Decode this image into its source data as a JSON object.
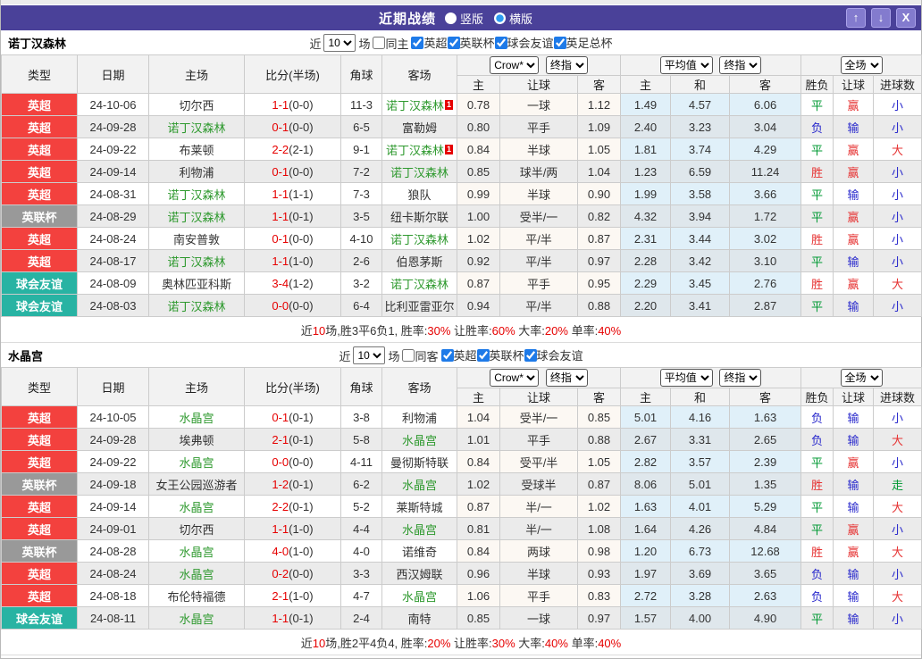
{
  "theme": {
    "titlebar_purple": "#4a4199",
    "epl_red": "#f3413e",
    "league_cup_gray": "#999999",
    "friendly_teal": "#28b3a3",
    "focus_team_green": "#2e992e",
    "score_red": "#e60000",
    "win_red": "#e63333",
    "draw_green": "#009933",
    "lose_blue": "#2929cc"
  },
  "titlebar": {
    "title": "近期战绩",
    "layout_options": [
      {
        "label": "竖版",
        "selected": false
      },
      {
        "label": "横版",
        "selected": true
      }
    ],
    "up_icon": "↑",
    "down_icon": "↓",
    "close_icon": "X"
  },
  "header": {
    "type": "类型",
    "date": "日期",
    "home": "主场",
    "score": "比分(半场)",
    "corner": "角球",
    "away": "客场",
    "odds_company": "Crow*",
    "odds_stage": "终指",
    "avg": "平均值",
    "avg_stage": "终指",
    "scope": "全场",
    "sub": [
      "主",
      "让球",
      "客",
      "主",
      "和",
      "客",
      "胜负",
      "让球",
      "进球数"
    ]
  },
  "tables": [
    {
      "team": "诺丁汉森林",
      "filter": {
        "near_label": "近",
        "games_value": "10",
        "games_label": "场",
        "same_label": "同主",
        "same_checked": false,
        "leagues": [
          {
            "label": "英超",
            "checked": true
          },
          {
            "label": "英联杯",
            "checked": true
          },
          {
            "label": "球会友谊",
            "checked": true
          },
          {
            "label": "英足总杯",
            "checked": true
          }
        ]
      },
      "rows": [
        {
          "league": "英超",
          "lg": "epl",
          "date": "24-10-06",
          "home": "切尔西",
          "home_focus": false,
          "score": "1-1",
          "half": "(0-0)",
          "corner": "11-3",
          "away": "诺丁汉森林",
          "away_focus": true,
          "away_rc": "1",
          "odds": [
            "0.78",
            "一球",
            "1.12"
          ],
          "avg": [
            "1.49",
            "4.57",
            "6.06"
          ],
          "res": [
            [
              "平",
              "g"
            ],
            [
              "赢",
              "r"
            ],
            [
              "小",
              "b"
            ]
          ]
        },
        {
          "league": "英超",
          "lg": "epl",
          "date": "24-09-28",
          "home": "诺丁汉森林",
          "home_focus": true,
          "score": "0-1",
          "half": "(0-0)",
          "corner": "6-5",
          "away": "富勒姆",
          "away_focus": false,
          "odds": [
            "0.80",
            "平手",
            "1.09"
          ],
          "avg": [
            "2.40",
            "3.23",
            "3.04"
          ],
          "res": [
            [
              "负",
              "b"
            ],
            [
              "输",
              "b"
            ],
            [
              "小",
              "b"
            ]
          ]
        },
        {
          "league": "英超",
          "lg": "epl",
          "date": "24-09-22",
          "home": "布莱顿",
          "home_focus": false,
          "score": "2-2",
          "half": "(2-1)",
          "corner": "9-1",
          "away": "诺丁汉森林",
          "away_focus": true,
          "away_rc": "1",
          "odds": [
            "0.84",
            "半球",
            "1.05"
          ],
          "avg": [
            "1.81",
            "3.74",
            "4.29"
          ],
          "res": [
            [
              "平",
              "g"
            ],
            [
              "赢",
              "r"
            ],
            [
              "大",
              "r"
            ]
          ]
        },
        {
          "league": "英超",
          "lg": "epl",
          "date": "24-09-14",
          "home": "利物浦",
          "home_focus": false,
          "score": "0-1",
          "half": "(0-0)",
          "corner": "7-2",
          "away": "诺丁汉森林",
          "away_focus": true,
          "odds": [
            "0.85",
            "球半/两",
            "1.04"
          ],
          "avg": [
            "1.23",
            "6.59",
            "11.24"
          ],
          "res": [
            [
              "胜",
              "r"
            ],
            [
              "赢",
              "r"
            ],
            [
              "小",
              "b"
            ]
          ]
        },
        {
          "league": "英超",
          "lg": "epl",
          "date": "24-08-31",
          "home": "诺丁汉森林",
          "home_focus": true,
          "score": "1-1",
          "half": "(1-1)",
          "corner": "7-3",
          "away": "狼队",
          "away_focus": false,
          "odds": [
            "0.99",
            "半球",
            "0.90"
          ],
          "avg": [
            "1.99",
            "3.58",
            "3.66"
          ],
          "res": [
            [
              "平",
              "g"
            ],
            [
              "输",
              "b"
            ],
            [
              "小",
              "b"
            ]
          ]
        },
        {
          "league": "英联杯",
          "lg": "cup",
          "date": "24-08-29",
          "home": "诺丁汉森林",
          "home_focus": true,
          "score": "1-1",
          "half": "(0-1)",
          "corner": "3-5",
          "away": "纽卡斯尔联",
          "away_focus": false,
          "odds": [
            "1.00",
            "受半/一",
            "0.82"
          ],
          "avg": [
            "4.32",
            "3.94",
            "1.72"
          ],
          "res": [
            [
              "平",
              "g"
            ],
            [
              "赢",
              "r"
            ],
            [
              "小",
              "b"
            ]
          ]
        },
        {
          "league": "英超",
          "lg": "epl",
          "date": "24-08-24",
          "home": "南安普敦",
          "home_focus": false,
          "score": "0-1",
          "half": "(0-0)",
          "corner": "4-10",
          "away": "诺丁汉森林",
          "away_focus": true,
          "odds": [
            "1.02",
            "平/半",
            "0.87"
          ],
          "avg": [
            "2.31",
            "3.44",
            "3.02"
          ],
          "res": [
            [
              "胜",
              "r"
            ],
            [
              "赢",
              "r"
            ],
            [
              "小",
              "b"
            ]
          ]
        },
        {
          "league": "英超",
          "lg": "epl",
          "date": "24-08-17",
          "home": "诺丁汉森林",
          "home_focus": true,
          "score": "1-1",
          "half": "(1-0)",
          "corner": "2-6",
          "away": "伯恩茅斯",
          "away_focus": false,
          "odds": [
            "0.92",
            "平/半",
            "0.97"
          ],
          "avg": [
            "2.28",
            "3.42",
            "3.10"
          ],
          "res": [
            [
              "平",
              "g"
            ],
            [
              "输",
              "b"
            ],
            [
              "小",
              "b"
            ]
          ]
        },
        {
          "league": "球会友谊",
          "lg": "fr",
          "date": "24-08-09",
          "home": "奥林匹亚科斯",
          "home_focus": false,
          "score": "3-4",
          "half": "(1-2)",
          "corner": "3-2",
          "away": "诺丁汉森林",
          "away_focus": true,
          "odds": [
            "0.87",
            "平手",
            "0.95"
          ],
          "avg": [
            "2.29",
            "3.45",
            "2.76"
          ],
          "res": [
            [
              "胜",
              "r"
            ],
            [
              "赢",
              "r"
            ],
            [
              "大",
              "r"
            ]
          ]
        },
        {
          "league": "球会友谊",
          "lg": "fr",
          "date": "24-08-03",
          "home": "诺丁汉森林",
          "home_focus": true,
          "score": "0-0",
          "half": "(0-0)",
          "corner": "6-4",
          "away": "比利亚雷亚尔",
          "away_focus": false,
          "odds": [
            "0.94",
            "平/半",
            "0.88"
          ],
          "avg": [
            "2.20",
            "3.41",
            "2.87"
          ],
          "res": [
            [
              "平",
              "g"
            ],
            [
              "输",
              "b"
            ],
            [
              "小",
              "b"
            ]
          ]
        }
      ],
      "summary": [
        {
          "t": "近",
          "c": "k"
        },
        {
          "t": "10",
          "c": "r"
        },
        {
          "t": "场,胜3平6负1, 胜率:",
          "c": "k"
        },
        {
          "t": "30%",
          "c": "r"
        },
        {
          "t": " 让胜率:",
          "c": "k"
        },
        {
          "t": "60%",
          "c": "r"
        },
        {
          "t": " 大率:",
          "c": "k"
        },
        {
          "t": "20%",
          "c": "r"
        },
        {
          "t": " 单率:",
          "c": "k"
        },
        {
          "t": "40%",
          "c": "r"
        }
      ]
    },
    {
      "team": "水晶宫",
      "filter": {
        "near_label": "近",
        "games_value": "10",
        "games_label": "场",
        "same_label": "同客",
        "same_checked": false,
        "leagues": [
          {
            "label": "英超",
            "checked": true
          },
          {
            "label": "英联杯",
            "checked": true
          },
          {
            "label": "球会友谊",
            "checked": true
          }
        ]
      },
      "rows": [
        {
          "league": "英超",
          "lg": "epl",
          "date": "24-10-05",
          "home": "水晶宫",
          "home_focus": true,
          "score": "0-1",
          "half": "(0-1)",
          "corner": "3-8",
          "away": "利物浦",
          "away_focus": false,
          "odds": [
            "1.04",
            "受半/一",
            "0.85"
          ],
          "avg": [
            "5.01",
            "4.16",
            "1.63"
          ],
          "res": [
            [
              "负",
              "b"
            ],
            [
              "输",
              "b"
            ],
            [
              "小",
              "b"
            ]
          ]
        },
        {
          "league": "英超",
          "lg": "epl",
          "date": "24-09-28",
          "home": "埃弗顿",
          "home_focus": false,
          "score": "2-1",
          "half": "(0-1)",
          "corner": "5-8",
          "away": "水晶宫",
          "away_focus": true,
          "odds": [
            "1.01",
            "平手",
            "0.88"
          ],
          "avg": [
            "2.67",
            "3.31",
            "2.65"
          ],
          "res": [
            [
              "负",
              "b"
            ],
            [
              "输",
              "b"
            ],
            [
              "大",
              "r"
            ]
          ]
        },
        {
          "league": "英超",
          "lg": "epl",
          "date": "24-09-22",
          "home": "水晶宫",
          "home_focus": true,
          "score": "0-0",
          "half": "(0-0)",
          "corner": "4-11",
          "away": "曼彻斯特联",
          "away_focus": false,
          "odds": [
            "0.84",
            "受平/半",
            "1.05"
          ],
          "avg": [
            "2.82",
            "3.57",
            "2.39"
          ],
          "res": [
            [
              "平",
              "g"
            ],
            [
              "赢",
              "r"
            ],
            [
              "小",
              "b"
            ]
          ]
        },
        {
          "league": "英联杯",
          "lg": "cup",
          "date": "24-09-18",
          "home": "女王公园巡游者",
          "home_focus": false,
          "score": "1-2",
          "half": "(0-1)",
          "corner": "6-2",
          "away": "水晶宫",
          "away_focus": true,
          "odds": [
            "1.02",
            "受球半",
            "0.87"
          ],
          "avg": [
            "8.06",
            "5.01",
            "1.35"
          ],
          "res": [
            [
              "胜",
              "r"
            ],
            [
              "输",
              "b"
            ],
            [
              "走",
              "g"
            ]
          ]
        },
        {
          "league": "英超",
          "lg": "epl",
          "date": "24-09-14",
          "home": "水晶宫",
          "home_focus": true,
          "score": "2-2",
          "half": "(0-1)",
          "corner": "5-2",
          "away": "莱斯特城",
          "away_focus": false,
          "odds": [
            "0.87",
            "半/一",
            "1.02"
          ],
          "avg": [
            "1.63",
            "4.01",
            "5.29"
          ],
          "res": [
            [
              "平",
              "g"
            ],
            [
              "输",
              "b"
            ],
            [
              "大",
              "r"
            ]
          ]
        },
        {
          "league": "英超",
          "lg": "epl",
          "date": "24-09-01",
          "home": "切尔西",
          "home_focus": false,
          "score": "1-1",
          "half": "(1-0)",
          "corner": "4-4",
          "away": "水晶宫",
          "away_focus": true,
          "odds": [
            "0.81",
            "半/一",
            "1.08"
          ],
          "avg": [
            "1.64",
            "4.26",
            "4.84"
          ],
          "res": [
            [
              "平",
              "g"
            ],
            [
              "赢",
              "r"
            ],
            [
              "小",
              "b"
            ]
          ]
        },
        {
          "league": "英联杯",
          "lg": "cup",
          "date": "24-08-28",
          "home": "水晶宫",
          "home_focus": true,
          "score": "4-0",
          "half": "(1-0)",
          "corner": "4-0",
          "away": "诺维奇",
          "away_focus": false,
          "odds": [
            "0.84",
            "两球",
            "0.98"
          ],
          "avg": [
            "1.20",
            "6.73",
            "12.68"
          ],
          "res": [
            [
              "胜",
              "r"
            ],
            [
              "赢",
              "r"
            ],
            [
              "大",
              "r"
            ]
          ]
        },
        {
          "league": "英超",
          "lg": "epl",
          "date": "24-08-24",
          "home": "水晶宫",
          "home_focus": true,
          "score": "0-2",
          "half": "(0-0)",
          "corner": "3-3",
          "away": "西汉姆联",
          "away_focus": false,
          "odds": [
            "0.96",
            "半球",
            "0.93"
          ],
          "avg": [
            "1.97",
            "3.69",
            "3.65"
          ],
          "res": [
            [
              "负",
              "b"
            ],
            [
              "输",
              "b"
            ],
            [
              "小",
              "b"
            ]
          ]
        },
        {
          "league": "英超",
          "lg": "epl",
          "date": "24-08-18",
          "home": "布伦特福德",
          "home_focus": false,
          "score": "2-1",
          "half": "(1-0)",
          "corner": "4-7",
          "away": "水晶宫",
          "away_focus": true,
          "odds": [
            "1.06",
            "平手",
            "0.83"
          ],
          "avg": [
            "2.72",
            "3.28",
            "2.63"
          ],
          "res": [
            [
              "负",
              "b"
            ],
            [
              "输",
              "b"
            ],
            [
              "大",
              "r"
            ]
          ]
        },
        {
          "league": "球会友谊",
          "lg": "fr",
          "date": "24-08-11",
          "home": "水晶宫",
          "home_focus": true,
          "score": "1-1",
          "half": "(0-1)",
          "corner": "2-4",
          "away": "南特",
          "away_focus": false,
          "odds": [
            "0.85",
            "一球",
            "0.97"
          ],
          "avg": [
            "1.57",
            "4.00",
            "4.90"
          ],
          "res": [
            [
              "平",
              "g"
            ],
            [
              "输",
              "b"
            ],
            [
              "小",
              "b"
            ]
          ]
        }
      ],
      "summary": [
        {
          "t": "近",
          "c": "k"
        },
        {
          "t": "10",
          "c": "r"
        },
        {
          "t": "场,胜2平4负4, 胜率:",
          "c": "k"
        },
        {
          "t": "20%",
          "c": "r"
        },
        {
          "t": " 让胜率:",
          "c": "k"
        },
        {
          "t": "30%",
          "c": "r"
        },
        {
          "t": " 大率:",
          "c": "k"
        },
        {
          "t": "40%",
          "c": "r"
        },
        {
          "t": " 单率:",
          "c": "k"
        },
        {
          "t": "40%",
          "c": "r"
        }
      ]
    }
  ]
}
